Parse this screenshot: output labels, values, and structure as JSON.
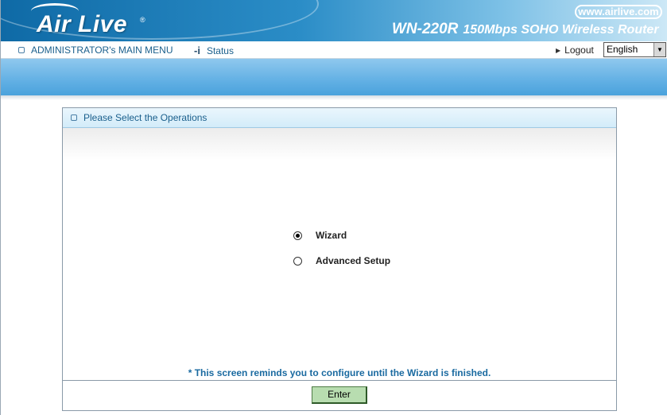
{
  "header": {
    "logo_text": "Air Live",
    "logo_reg": "®",
    "url": "www.airlive.com",
    "model": "WN-220R",
    "description": "150Mbps SOHO Wireless Router"
  },
  "menu": {
    "main_menu": "ADMINISTRATOR's MAIN MENU",
    "status": "Status",
    "logout": "Logout",
    "language": "English"
  },
  "panel": {
    "title": "Please Select the Operations",
    "options": [
      {
        "label": "Wizard",
        "checked": true
      },
      {
        "label": "Advanced Setup",
        "checked": false
      }
    ],
    "note": "* This screen reminds you to configure until the Wizard is finished.",
    "enter_label": "Enter"
  },
  "colors": {
    "banner_blue": "#0f6aa6",
    "menu_text": "#1a5f8c",
    "button_green": "#b8ddb0"
  }
}
